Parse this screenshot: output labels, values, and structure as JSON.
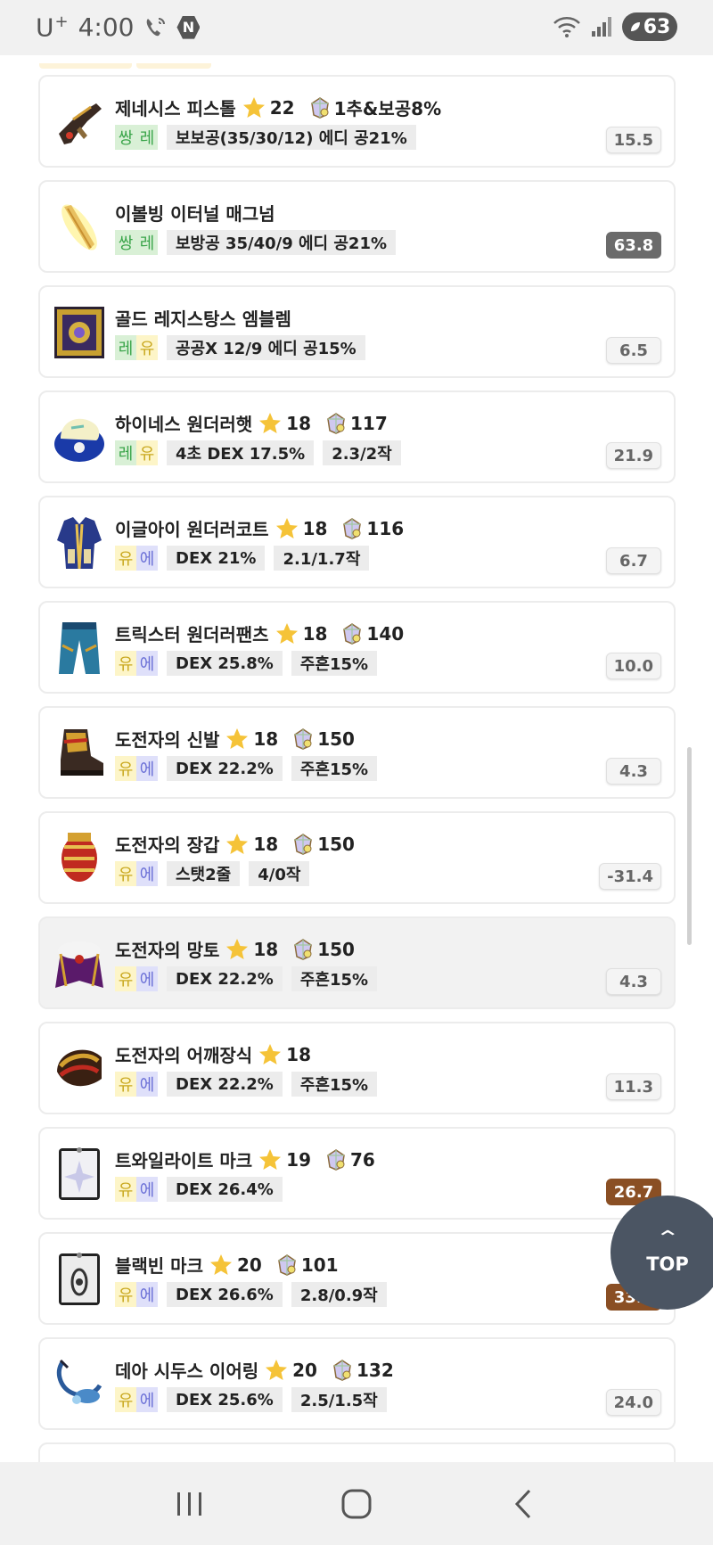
{
  "status_bar": {
    "carrier": "U",
    "carrier_sup": "+",
    "time": "4:00",
    "n_badge": "N",
    "battery": "63"
  },
  "colors": {
    "green_grade_bg": "#d9f0d6",
    "green_grade_text": "#3aa54a",
    "yellow_grade_bg": "#fdf5c8",
    "yellow_grade_text": "#c9a81f",
    "unique_blue_bg": "#dfe0fa",
    "unique_blue_text": "#6a6fd6",
    "score_gray": "#6b6b6b",
    "score_brown": "#8a4f24",
    "top_button": "#4b5563"
  },
  "items": [
    {
      "name": "제네시스 피스톨",
      "star": "22",
      "gem": "1추&보공8%",
      "grade": [
        "쌍",
        "레"
      ],
      "grade_style": "green",
      "options": [
        "보보공(35/30/12) 에디 공21%"
      ],
      "score": "15.5",
      "score_style": "plain",
      "icon": "pistol-icon"
    },
    {
      "name": "이볼빙 이터널 매그넘",
      "star": "",
      "gem": "",
      "grade": [
        "쌍",
        "레"
      ],
      "grade_style": "green",
      "options": [
        "보방공 35/40/9 에디 공21%"
      ],
      "score": "63.8",
      "score_style": "gray",
      "icon": "bullet-icon"
    },
    {
      "name": "골드 레지스탕스 엠블렘",
      "star": "",
      "gem": "",
      "grade": [
        "레",
        "유"
      ],
      "grade_style": "green-yellow",
      "options": [
        "공공X 12/9 에디 공15%"
      ],
      "score": "6.5",
      "score_style": "plain",
      "icon": "emblem-icon"
    },
    {
      "name": "하이네스 원더러햇",
      "star": "18",
      "gem": "117",
      "grade": [
        "레",
        "유"
      ],
      "grade_style": "green-yellow",
      "options": [
        "4초 DEX 17.5%",
        "2.3/2작"
      ],
      "score": "21.9",
      "score_style": "plain",
      "icon": "hat-icon"
    },
    {
      "name": "이글아이 원더러코트",
      "star": "18",
      "gem": "116",
      "grade": [
        "유",
        "에"
      ],
      "grade_style": "yellow-blue",
      "options": [
        "DEX 21%",
        "2.1/1.7작"
      ],
      "score": "6.7",
      "score_style": "plain",
      "icon": "coat-icon"
    },
    {
      "name": "트릭스터 원더러팬츠",
      "star": "18",
      "gem": "140",
      "grade": [
        "유",
        "에"
      ],
      "grade_style": "yellow-blue",
      "options": [
        "DEX 25.8%",
        "주흔15%"
      ],
      "score": "10.0",
      "score_style": "plain",
      "icon": "pants-icon"
    },
    {
      "name": "도전자의 신발",
      "star": "18",
      "gem": "150",
      "grade": [
        "유",
        "에"
      ],
      "grade_style": "yellow-blue",
      "options": [
        "DEX 22.2%",
        "주흔15%"
      ],
      "score": "4.3",
      "score_style": "plain",
      "icon": "shoes-icon"
    },
    {
      "name": "도전자의 장갑",
      "star": "18",
      "gem": "150",
      "grade": [
        "유",
        "에"
      ],
      "grade_style": "yellow-blue",
      "options": [
        "스탯2줄",
        "4/0작"
      ],
      "score": "-31.4",
      "score_style": "plain",
      "icon": "gloves-icon"
    },
    {
      "name": "도전자의 망토",
      "star": "18",
      "gem": "150",
      "grade": [
        "유",
        "에"
      ],
      "grade_style": "yellow-blue",
      "options": [
        "DEX 22.2%",
        "주흔15%"
      ],
      "score": "4.3",
      "score_style": "plain",
      "icon": "cape-icon"
    },
    {
      "name": "도전자의 어깨장식",
      "star": "18",
      "gem": "",
      "grade": [
        "유",
        "에"
      ],
      "grade_style": "yellow-blue",
      "options": [
        "DEX 22.2%",
        "주흔15%"
      ],
      "score": "11.3",
      "score_style": "plain",
      "icon": "shoulder-icon"
    },
    {
      "name": "트와일라이트 마크",
      "star": "19",
      "gem": "76",
      "grade": [
        "유",
        "에"
      ],
      "grade_style": "yellow-blue",
      "options": [
        "DEX 26.4%"
      ],
      "score": "26.7",
      "score_style": "brown",
      "icon": "twilight-mark-icon"
    },
    {
      "name": "블랙빈 마크",
      "star": "20",
      "gem": "101",
      "grade": [
        "유",
        "에"
      ],
      "grade_style": "yellow-blue",
      "options": [
        "DEX 26.6%",
        "2.8/0.9작"
      ],
      "score": "33.0",
      "score_style": "brown",
      "icon": "blackbean-mark-icon"
    },
    {
      "name": "데아 시두스 이어링",
      "star": "20",
      "gem": "132",
      "grade": [
        "유",
        "에"
      ],
      "grade_style": "yellow-blue",
      "options": [
        "DEX 25.6%",
        "2.5/1.5작"
      ],
      "score": "24.0",
      "score_style": "plain",
      "icon": "earring-icon"
    }
  ],
  "top_button": {
    "label": "TOP"
  },
  "nav": {
    "recent": "recent-apps-icon",
    "home": "home-icon",
    "back": "back-icon"
  }
}
